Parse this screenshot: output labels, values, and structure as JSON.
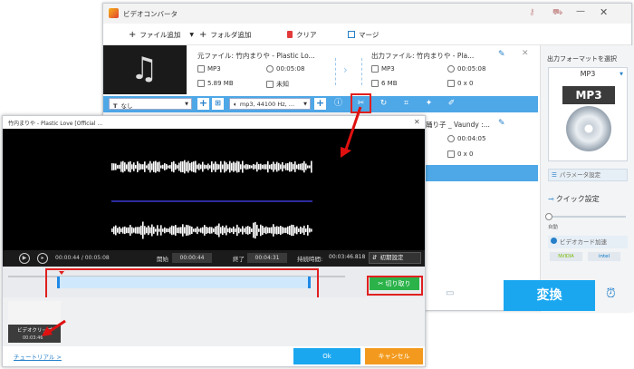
{
  "main": {
    "title": "ビデオコンバータ",
    "menu": {
      "add_file": "ファイル追加",
      "add_folder": "フォルダ追加",
      "clear": "クリア",
      "merge": "マージ"
    },
    "item1": {
      "source_label": "元ファイル: 竹内まりや - Plastic Lo...",
      "output_label": "出力ファイル: 竹内まりや - Pla...",
      "src_format": "MP3",
      "src_duration": "00:05:08",
      "src_size": "5.89 MB",
      "src_res": "未知",
      "out_format": "MP3",
      "out_duration": "00:05:08",
      "out_size": "6 MB",
      "out_res": "0 x 0"
    },
    "edit_bar": {
      "subtitle": "なし",
      "audio": "mp3, 44100 Hz, ..."
    },
    "item2": {
      "output_label": "踊り子 _ Vaundy :...",
      "duration": "00:04:05",
      "res": "0 x 0"
    },
    "right_panel": {
      "select_format": "出力フォーマットを選択",
      "format": "MP3",
      "format_badge": "MP3",
      "param_settings": "パラメータ設定",
      "quick_settings": "クイック設定",
      "auto": "自動",
      "gpu_accel": "ビデオカード加速",
      "nvidia": "NVIDIA",
      "intel": "intel"
    },
    "convert": "変換"
  },
  "editor": {
    "title": "竹内まりや - Plastic Love [Official ...",
    "current_time": "00:00:44",
    "total_time": "00:05:08",
    "start_label": "開始",
    "start_value": "00:00:44",
    "end_label": "終了",
    "end_value": "00:04:31",
    "duration_label": "持続時間:",
    "duration_value": "00:03:46.818",
    "reset": "初期設定",
    "cut": "切り取り",
    "clip_name": "ビデオクリップ",
    "clip_time": "00:03:46",
    "tutorial": "チュートリアル >",
    "ok": "Ok",
    "cancel": "キャンセル"
  },
  "colors": {
    "accent_blue": "#4ea7e7",
    "convert_blue": "#1aa7f0",
    "cut_green": "#2bb34a",
    "cancel_orange": "#f39a1e",
    "highlight_red": "#e02020"
  }
}
